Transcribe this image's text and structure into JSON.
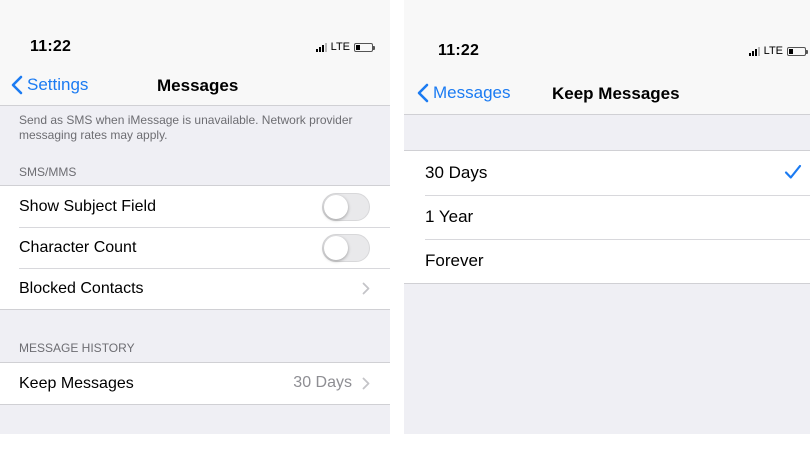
{
  "left": {
    "status": {
      "time": "11:22",
      "network": "LTE"
    },
    "nav": {
      "back_label": "Settings",
      "title": "Messages"
    },
    "footer_note": "Send as SMS when iMessage is unavailable. Network provider messaging rates may apply.",
    "sms_section": {
      "header": "SMS/MMS",
      "items": [
        {
          "label": "Show Subject Field",
          "control": "toggle",
          "on": false
        },
        {
          "label": "Character Count",
          "control": "toggle",
          "on": false
        },
        {
          "label": "Blocked Contacts",
          "control": "chevron"
        }
      ]
    },
    "history_section": {
      "header": "MESSAGE HISTORY",
      "items": [
        {
          "label": "Keep Messages",
          "value": "30 Days"
        }
      ]
    }
  },
  "right": {
    "status": {
      "time": "11:22",
      "network": "LTE"
    },
    "nav": {
      "back_label": "Messages",
      "title": "Keep Messages"
    },
    "options": [
      {
        "label": "30 Days",
        "selected": true
      },
      {
        "label": "1 Year",
        "selected": false
      },
      {
        "label": "Forever",
        "selected": false
      }
    ]
  },
  "colors": {
    "accent": "#1b7bf2",
    "background": "#efeff4",
    "secondary_text": "#6d6d72"
  },
  "icons": [
    "chevron-left-icon",
    "chevron-right-icon",
    "checkmark-icon",
    "signal-icon",
    "battery-icon"
  ]
}
